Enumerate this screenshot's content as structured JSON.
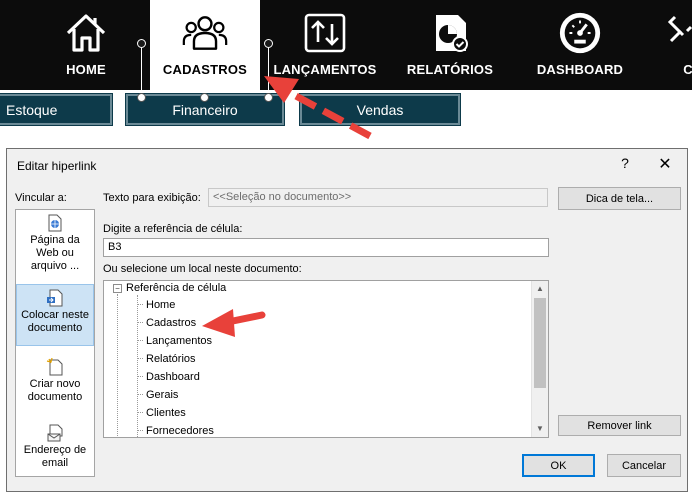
{
  "ribbon": {
    "items": [
      {
        "label": "HOME",
        "icon": "home-icon"
      },
      {
        "label": "CADASTROS",
        "icon": "users-icon"
      },
      {
        "label": "LANÇAMENTOS",
        "icon": "transfer-arrows-icon"
      },
      {
        "label": "RELATÓRIOS",
        "icon": "report-icon"
      },
      {
        "label": "DASHBOARD",
        "icon": "speedometer-icon"
      },
      {
        "label": "C",
        "icon": "tools-icon"
      }
    ],
    "active": "CADASTROS",
    "background": "#0c0c0c"
  },
  "subtabs": [
    {
      "label": "Estoque"
    },
    {
      "label": "Financeiro"
    },
    {
      "label": "Vendas"
    }
  ],
  "subtab_color": "#0d3a4a",
  "arrow_color": "#e8413a",
  "dialog": {
    "title": "Editar hiperlink",
    "help": "?",
    "close": "✕",
    "link_to_label": "Vincular a:",
    "link_options": [
      {
        "label": "Página da Web ou arquivo ...",
        "lines": [
          "Página da",
          "Web ou",
          "arquivo ..."
        ],
        "icon": "web-page-icon"
      },
      {
        "label": "Colocar neste documento",
        "lines": [
          "Colocar neste",
          "documento"
        ],
        "icon": "place-in-document-icon",
        "active": true
      },
      {
        "label": "Criar novo documento",
        "lines": [
          "Criar novo",
          "documento"
        ],
        "icon": "new-document-icon"
      },
      {
        "label": "Endereço de email",
        "lines": [
          "Endereço de",
          "email"
        ],
        "icon": "email-icon"
      }
    ],
    "display_text_label": "Texto para exibição:",
    "display_text_value": "<<Seleção no documento>>",
    "screentip_button": "Dica de tela...",
    "cell_ref_label": "Digite a referência de célula:",
    "cell_ref_value": "B3",
    "place_label": "Ou selecione um local neste documento:",
    "tree": {
      "root": "Referência de célula",
      "toggle": "−",
      "items": [
        "Home",
        "Cadastros",
        "Lançamentos",
        "Relatórios",
        "Dashboard",
        "Gerais",
        "Clientes",
        "Fornecedores"
      ]
    },
    "remove_link_button": "Remover link",
    "ok_button": "OK",
    "cancel_button": "Cancelar"
  }
}
